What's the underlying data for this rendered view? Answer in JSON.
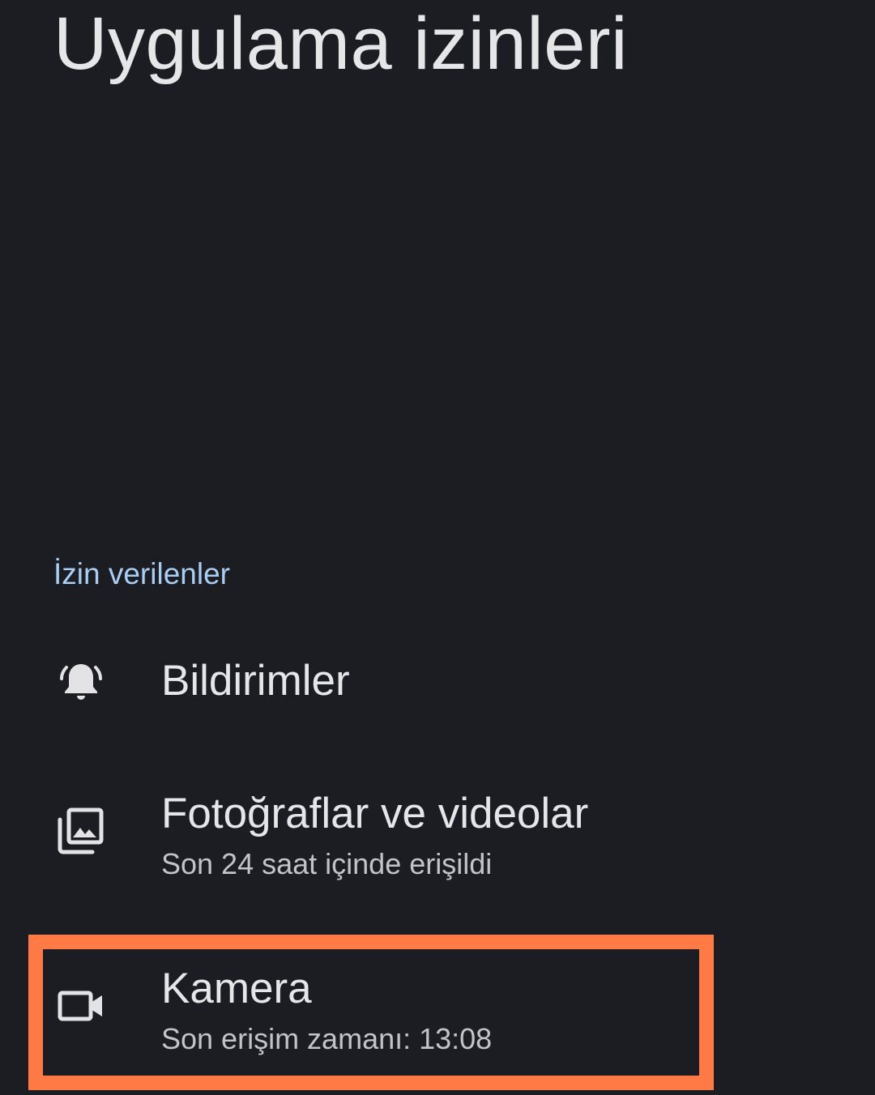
{
  "header": {
    "title": "Uygulama izinleri"
  },
  "section": {
    "allowed_label": "İzin verilenler"
  },
  "permissions": [
    {
      "icon": "bell-icon",
      "title": "Bildirimler",
      "subtitle": ""
    },
    {
      "icon": "photo-library-icon",
      "title": "Fotoğraflar ve videolar",
      "subtitle": "Son 24 saat içinde erişildi"
    },
    {
      "icon": "video-camera-icon",
      "title": "Kamera",
      "subtitle": "Son erişim zamanı: 13:08"
    }
  ],
  "colors": {
    "background": "#1b1d22",
    "section_accent": "#a9cdf3",
    "highlight": "#ff7a45"
  }
}
